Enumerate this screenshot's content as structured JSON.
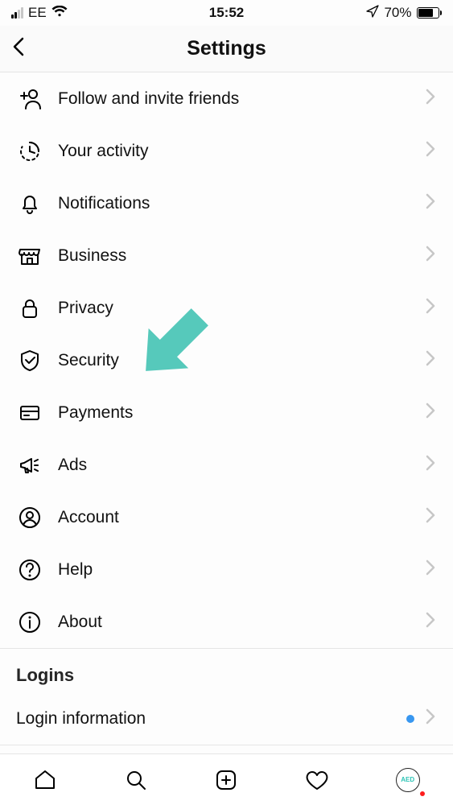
{
  "status": {
    "carrier": "EE",
    "time": "15:52",
    "battery_percent": "70%"
  },
  "header": {
    "title": "Settings"
  },
  "items": [
    {
      "key": "follow-invite",
      "label": "Follow and invite friends",
      "icon": "add-user-icon"
    },
    {
      "key": "activity",
      "label": "Your activity",
      "icon": "activity-clock-icon"
    },
    {
      "key": "notifications",
      "label": "Notifications",
      "icon": "bell-icon"
    },
    {
      "key": "business",
      "label": "Business",
      "icon": "storefront-icon"
    },
    {
      "key": "privacy",
      "label": "Privacy",
      "icon": "lock-icon"
    },
    {
      "key": "security",
      "label": "Security",
      "icon": "shield-check-icon"
    },
    {
      "key": "payments",
      "label": "Payments",
      "icon": "card-icon"
    },
    {
      "key": "ads",
      "label": "Ads",
      "icon": "megaphone-icon"
    },
    {
      "key": "account",
      "label": "Account",
      "icon": "account-circle-icon"
    },
    {
      "key": "help",
      "label": "Help",
      "icon": "help-circle-icon"
    },
    {
      "key": "about",
      "label": "About",
      "icon": "info-circle-icon"
    }
  ],
  "logins": {
    "section_title": "Logins",
    "login_info_label": "Login information",
    "login_info_dot": true
  },
  "annotation": {
    "type": "arrow",
    "color": "#56c9bb",
    "points_to": "security"
  },
  "tabs": {
    "avatar_text": "AED"
  }
}
